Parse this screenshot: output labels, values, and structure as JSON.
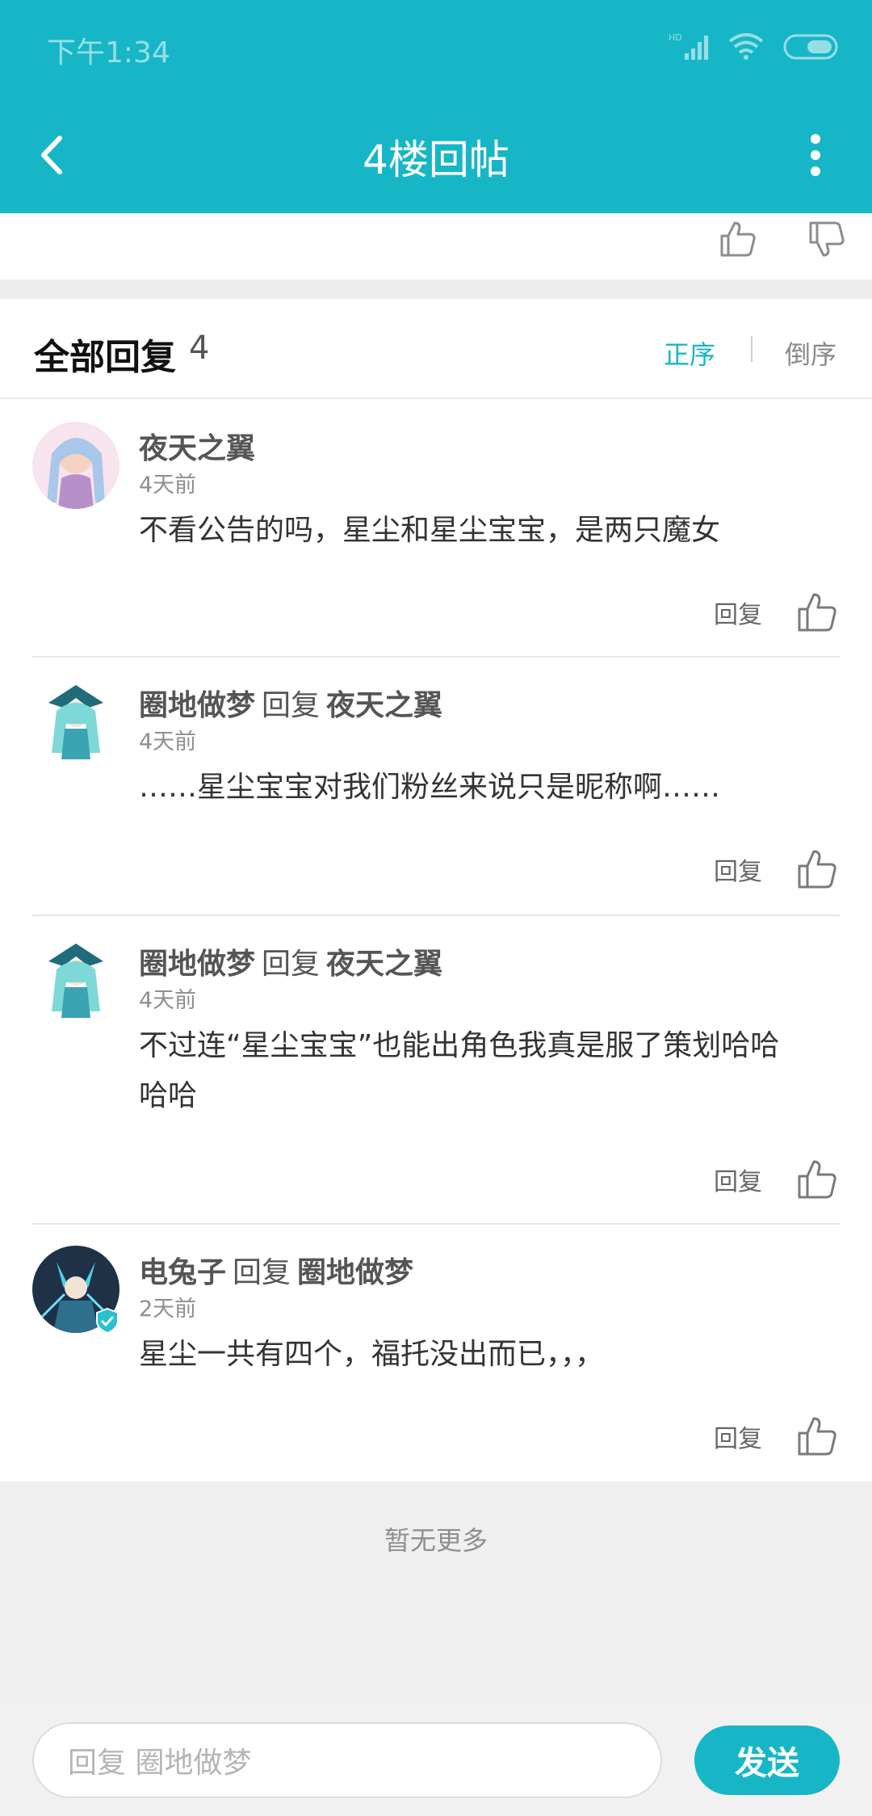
{
  "status": {
    "time": "下午1:34",
    "hd": "HD"
  },
  "header": {
    "title": "4楼回帖"
  },
  "replies_header": {
    "title": "全部回复",
    "count": "4",
    "sort_asc": "正序",
    "sort_desc": "倒序"
  },
  "replies": [
    {
      "author": "夜天之翼",
      "reply_word": "",
      "target": "",
      "time": "4天前",
      "content_lines": [
        "不看公告的吗，星尘和星尘宝宝，是两只魔女",
        ""
      ],
      "reply_label": "回复",
      "avatar_color": "#f3d6e7"
    },
    {
      "author": "圈地做梦",
      "reply_word": "回复",
      "target": "夜天之翼",
      "time": "4天前",
      "content_lines": [
        "……星尘宝宝对我们粉丝来说只是昵称啊……",
        ""
      ],
      "reply_label": "回复",
      "avatar_color": "#d6f3f3"
    },
    {
      "author": "圈地做梦",
      "reply_word": "回复",
      "target": "夜天之翼",
      "time": "4天前",
      "content_lines": [
        "不过连“星尘宝宝”也能出角色我真是服了策划哈哈",
        "哈哈"
      ],
      "reply_label": "回复",
      "avatar_color": "#d6f3f3"
    },
    {
      "author": "电兔子",
      "reply_word": "回复",
      "target": "圈地做梦",
      "time": "2天前",
      "content_lines": [
        "星尘一共有四个，福托没出而已，，，",
        ""
      ],
      "reply_label": "回复",
      "avatar_color": "#1e3146"
    }
  ],
  "no_more": "暂无更多",
  "input": {
    "placeholder": "回复 圈地做梦"
  },
  "send_label": "发送",
  "colors": {
    "accent": "#17b6c7"
  }
}
